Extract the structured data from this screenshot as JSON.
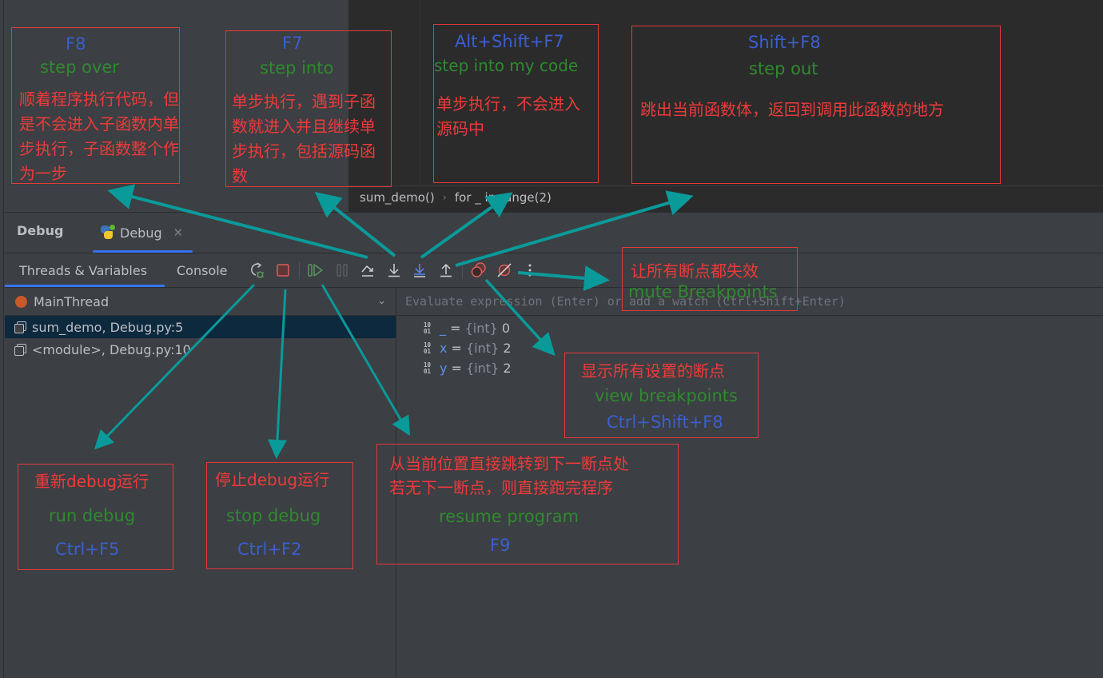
{
  "editor": {
    "breadcrumb": [
      "sum_demo()",
      "for _ in range(2)"
    ]
  },
  "tool_window": {
    "title": "Debug",
    "run_tab": {
      "label": "Debug",
      "icon": "python-icon",
      "close_icon": "close-icon"
    },
    "sub_tabs": [
      {
        "label": "Threads & Variables",
        "active": true
      },
      {
        "label": "Console",
        "active": false
      }
    ],
    "toolbar": [
      {
        "name": "rerun-debug",
        "icon": "rerun-debug-icon",
        "color": "#bcbec4"
      },
      {
        "name": "stop",
        "icon": "stop-icon",
        "color": "#db5c5c"
      },
      {
        "name": "resume",
        "icon": "resume-icon",
        "color": "#57965c"
      },
      {
        "name": "pause",
        "icon": "pause-icon",
        "color": "#5a5d63"
      },
      {
        "name": "step-over",
        "icon": "step-over-icon",
        "color": "#ced0d6"
      },
      {
        "name": "step-into",
        "icon": "step-into-icon",
        "color": "#ced0d6"
      },
      {
        "name": "step-into-my-code",
        "icon": "step-into-my-code-icon",
        "color": "#548af7"
      },
      {
        "name": "step-out",
        "icon": "step-out-icon",
        "color": "#ced0d6"
      },
      {
        "name": "view-breakpoints",
        "icon": "view-breakpoints-icon",
        "color": "#db5c5c"
      },
      {
        "name": "mute-breakpoints",
        "icon": "mute-breakpoints-icon",
        "color": "#db5c5c"
      },
      {
        "name": "more",
        "icon": "more-vertical-icon",
        "color": "#ced0d6"
      }
    ]
  },
  "frames": {
    "thread": "MainThread",
    "items": [
      {
        "label": "sum_demo, Debug.py:5",
        "selected": true
      },
      {
        "label": "<module>, Debug.py:10",
        "selected": false
      }
    ]
  },
  "variables": {
    "eval_placeholder": "Evaluate expression (Enter) or add a watch (Ctrl+Shift+Enter)",
    "items": [
      {
        "name": "_",
        "type": "{int}",
        "value": "0"
      },
      {
        "name": "x",
        "type": "{int}",
        "value": "2"
      },
      {
        "name": "y",
        "type": "{int}",
        "value": "2"
      }
    ]
  },
  "annotations": {
    "step_over": {
      "key": "F8",
      "en": "step over",
      "zh": "顺着程序执行代码，但是不会进入子函数内单步执行，子函数整个作为一步"
    },
    "step_into": {
      "key": "F7",
      "en": "step into",
      "zh": "单步执行，遇到子函数就进入并且继续单步执行，包括源码函数"
    },
    "step_into_my_code": {
      "key": "Alt+Shift+F7",
      "en": "step into my code",
      "zh": "单步执行，不会进入源码中"
    },
    "step_out": {
      "key": "Shift+F8",
      "en": "step out",
      "zh": "跳出当前函数体，返回到调用此函数的地方"
    },
    "mute_breakpoints": {
      "zh": "让所有断点都失效",
      "en": "mute Breakpoints"
    },
    "view_breakpoints": {
      "zh": "显示所有设置的断点",
      "en": "view breakpoints",
      "key": "Ctrl+Shift+F8"
    },
    "rerun_debug": {
      "zh": "重新debug运行",
      "en": "run debug",
      "key": "Ctrl+F5"
    },
    "stop_debug": {
      "zh": "停止debug运行",
      "en": "stop debug",
      "key": "Ctrl+F2"
    },
    "resume_program": {
      "zh": "从当前位置直接跳转到下一断点处若无下一断点，则直接跑完程序",
      "zh_line1": "从当前位置直接跳转到下一断点处",
      "zh_line2": "若无下一断点，则直接跑完程序",
      "en": "resume program",
      "key": "F9"
    }
  },
  "colors": {
    "annotation_border": "#e5393a",
    "annotation_key": "#3b5fd0",
    "annotation_en": "#2f8a2f",
    "annotation_zh": "#ee3a3a",
    "arrow": "#0a9a9a",
    "accent": "#3574f0"
  }
}
